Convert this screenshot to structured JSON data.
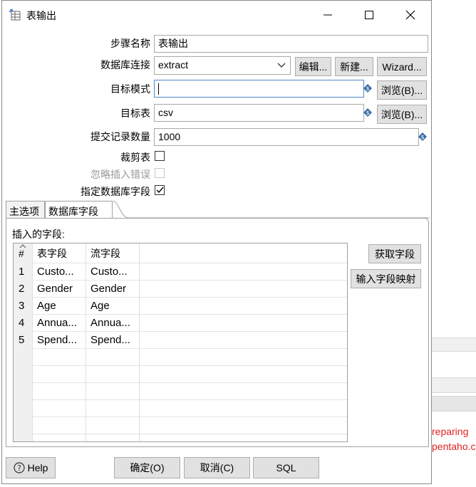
{
  "dialog": {
    "title": "表输出",
    "icon": "table-output-icon"
  },
  "form": {
    "step_name_label": "步骤名称",
    "step_name_value": "表输出",
    "db_conn_label": "数据库连接",
    "db_conn_value": "extract",
    "edit_button": "编辑...",
    "new_button": "新建...",
    "wizard_button": "Wizard...",
    "target_schema_label": "目标模式",
    "target_schema_value": "",
    "browse_button": "浏览(B)...",
    "target_table_label": "目标表",
    "target_table_value": "csv",
    "commit_size_label": "提交记录数量",
    "commit_size_value": "1000",
    "truncate_label": "裁剪表",
    "truncate_checked": false,
    "ignore_errors_label": "忽略插入错误",
    "ignore_errors_checked": false,
    "specify_fields_label": "指定数据库字段",
    "specify_fields_checked": true
  },
  "tabs": [
    {
      "label": "主选项",
      "active": false
    },
    {
      "label": "数据库字段",
      "active": true
    }
  ],
  "fields_section": {
    "label": "插入的字段:",
    "columns": [
      "#",
      "表字段",
      "流字段"
    ],
    "rows": [
      {
        "num": "1",
        "table_field": "Custo...",
        "stream_field": "Custo..."
      },
      {
        "num": "2",
        "table_field": "Gender",
        "stream_field": "Gender"
      },
      {
        "num": "3",
        "table_field": "Age",
        "stream_field": "Age"
      },
      {
        "num": "4",
        "table_field": "Annua...",
        "stream_field": "Annua..."
      },
      {
        "num": "5",
        "table_field": "Spend...",
        "stream_field": "Spend..."
      }
    ],
    "get_fields_button": "获取字段",
    "map_fields_button": "输入字段映射"
  },
  "bottom": {
    "help_button": "Help",
    "ok_button": "确定(O)",
    "cancel_button": "取消(C)",
    "sql_button": "SQL"
  },
  "background": {
    "log_line_1": "reparing",
    "log_line_2": "pentaho.c"
  },
  "colors": {
    "button_bg": "#e1e1e1",
    "focus_border": "#4d87c7",
    "error_text": "#e02020"
  }
}
